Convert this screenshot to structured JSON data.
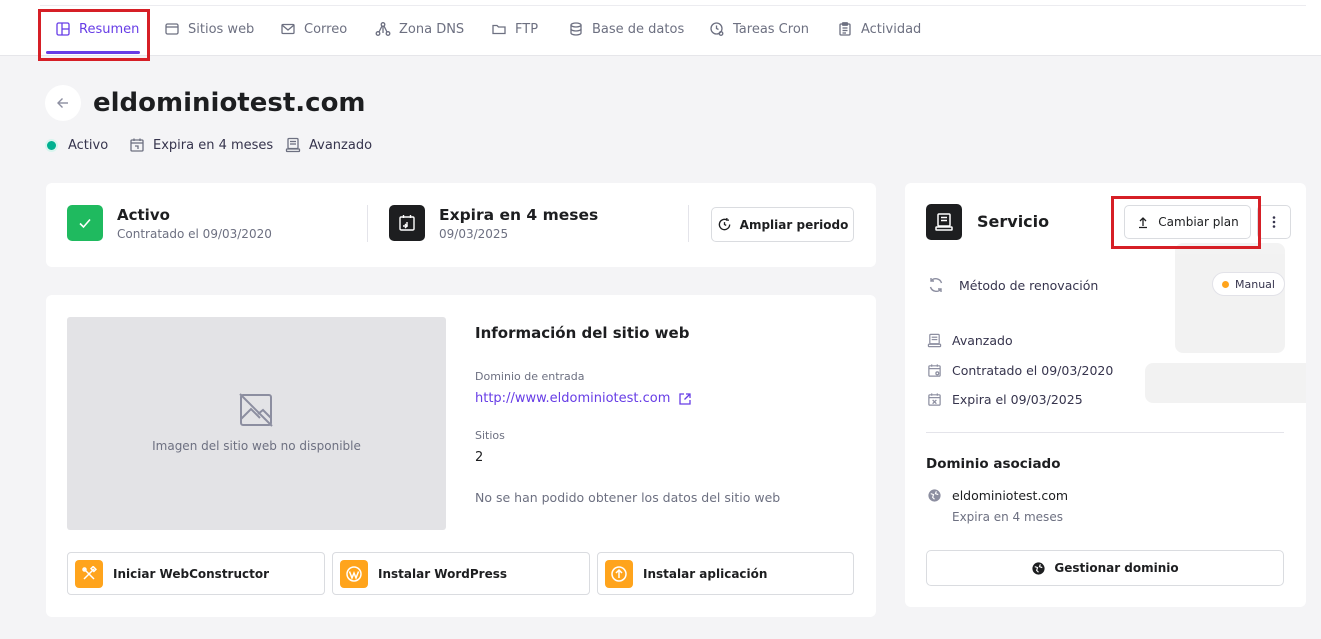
{
  "nav": {
    "tabs": [
      {
        "label": "Resumen",
        "icon": "layout-icon",
        "active": true
      },
      {
        "label": "Sitios web",
        "icon": "browser-icon"
      },
      {
        "label": "Correo",
        "icon": "mail-icon"
      },
      {
        "label": "Zona DNS",
        "icon": "network-icon"
      },
      {
        "label": "FTP",
        "icon": "folder-icon"
      },
      {
        "label": "Base de datos",
        "icon": "database-icon"
      },
      {
        "label": "Tareas Cron",
        "icon": "clock-icon"
      },
      {
        "label": "Actividad",
        "icon": "clipboard-icon"
      }
    ]
  },
  "header": {
    "title": "eldominiotest.com",
    "status": "Activo",
    "expiry": "Expira en 4 meses",
    "plan": "Avanzado"
  },
  "status_card": {
    "active_title": "Activo",
    "active_sub": "Contratado el 09/03/2020",
    "expiry_title": "Expira en 4 meses",
    "expiry_sub": "09/03/2025",
    "extend_button": "Ampliar periodo"
  },
  "site_card": {
    "image_unavailable": "Imagen del sitio web no disponible",
    "info_title": "Información del sitio web",
    "entry_domain_label": "Dominio de entrada",
    "entry_domain_value": "http://www.eldominiotest.com",
    "sites_label": "Sitios",
    "sites_value": "2",
    "error_text": "No se han podido obtener los datos del sitio web",
    "actions": [
      {
        "label": "Iniciar WebConstructor",
        "icon": "tools-icon"
      },
      {
        "label": "Instalar WordPress",
        "icon": "wordpress-icon"
      },
      {
        "label": "Instalar aplicación",
        "icon": "upload-icon"
      }
    ]
  },
  "service_card": {
    "title": "Servicio",
    "change_plan_button": "Cambiar plan",
    "renewal_label": "Método de renovación",
    "renewal_badge": "Manual",
    "plan": "Avanzado",
    "contracted": "Contratado el 09/03/2020",
    "expires": "Expira el 09/03/2025",
    "domain_section_title": "Dominio asociado",
    "domain": "eldominiotest.com",
    "domain_expiry": "Expira en 4 meses",
    "manage_domain_button": "Gestionar dominio"
  },
  "colors": {
    "accent": "#673de6",
    "success": "#00b090",
    "warning": "#ffa41c",
    "highlight": "#d61f26"
  }
}
